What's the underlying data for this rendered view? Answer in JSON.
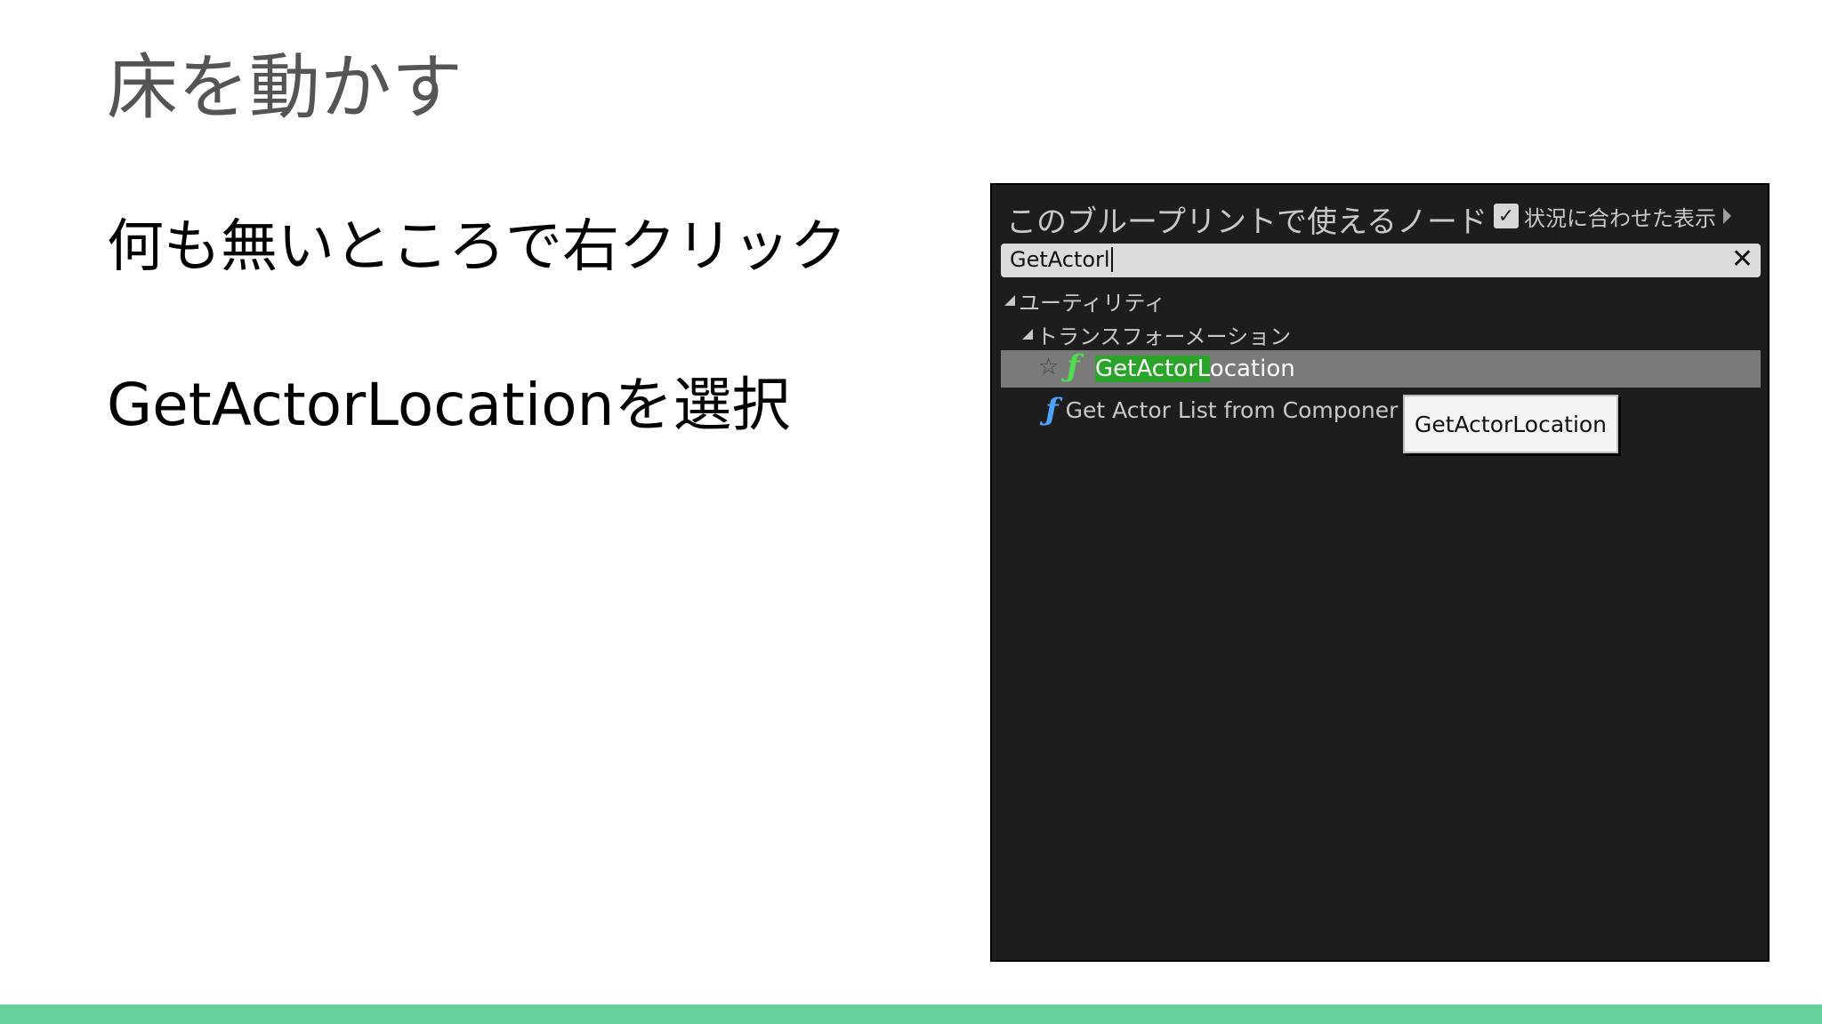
{
  "slide": {
    "title": "床を動かす",
    "bullets": [
      "何も無いところで右クリック",
      "GetActorLocationを選択"
    ]
  },
  "panel": {
    "title": "このブループリントで使えるノード",
    "context_sensitive_label": "状況に合わせた表示",
    "context_sensitive_checked": true,
    "search": {
      "value": "GetActorl"
    },
    "tree": {
      "category": "ユーティリティ",
      "subcategory": "トランスフォーメーション",
      "selected_item": {
        "highlight": "GetActorL",
        "rest": "ocation"
      },
      "items": [
        "Get Actor List from Componer"
      ]
    },
    "tooltip": "GetActorLocation",
    "icons": {
      "function": "function-icon",
      "favorite": "star-icon",
      "clear": "close-icon",
      "checkbox": "checkmark-icon",
      "expand": "chevron-right-icon"
    }
  },
  "colors": {
    "panel_bg": "#1d1d1d",
    "selected_row": "#7a7a7a",
    "match_highlight": "#2aa52a",
    "footer_band": "#66d19b"
  }
}
